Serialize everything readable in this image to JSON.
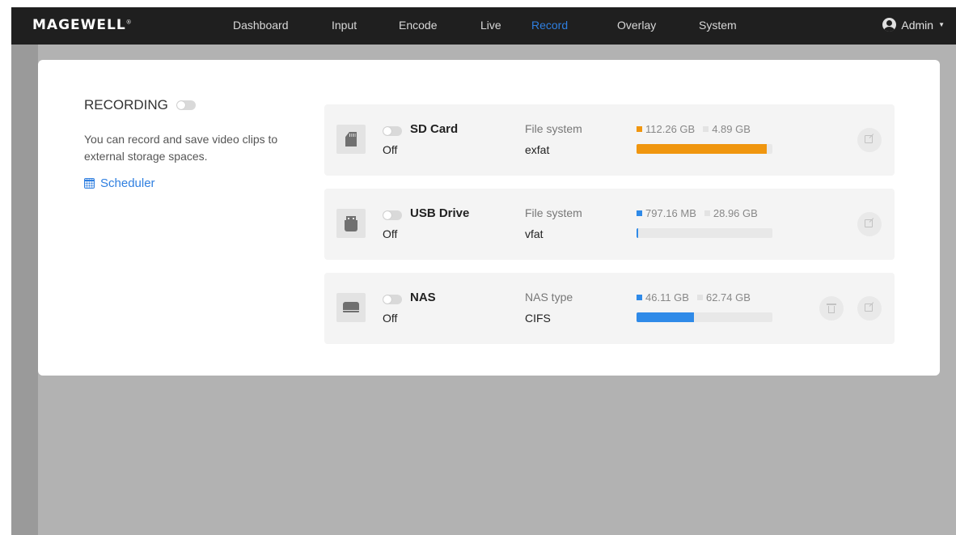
{
  "app": {
    "logo": "MAGEWELL",
    "logo_mark": "®"
  },
  "nav": {
    "items": [
      "Dashboard",
      "Input",
      "Encode",
      "Live",
      "Record",
      "Overlay",
      "System"
    ],
    "active": "Record"
  },
  "user": {
    "name": "Admin",
    "icon": "user-avatar-icon"
  },
  "recording": {
    "title": "RECORDING",
    "enabled": false,
    "description": "You can record and save video clips to external storage spaces.",
    "scheduler_label": "Scheduler"
  },
  "colors": {
    "accent": "#2f7fe0",
    "sd_bar": "#f0960f",
    "usb_bar": "#2f8ae8",
    "nas_bar": "#2f8ae8"
  },
  "storage": [
    {
      "name": "SD Card",
      "status": "Off",
      "enabled": false,
      "fs_label": "File system",
      "fs_value": "exfat",
      "used": "112.26 GB",
      "free": "4.89 GB",
      "used_fraction": 0.958,
      "icon": "sd-card-icon",
      "can_delete": false
    },
    {
      "name": "USB Drive",
      "status": "Off",
      "enabled": false,
      "fs_label": "File system",
      "fs_value": "vfat",
      "used": "797.16 MB",
      "free": "28.96 GB",
      "used_fraction": 0.012,
      "icon": "usb-drive-icon",
      "can_delete": false
    },
    {
      "name": "NAS",
      "status": "Off",
      "enabled": false,
      "fs_label": "NAS type",
      "fs_value": "CIFS",
      "used": "46.11 GB",
      "free": "62.74 GB",
      "used_fraction": 0.424,
      "icon": "nas-icon",
      "can_delete": true
    }
  ]
}
